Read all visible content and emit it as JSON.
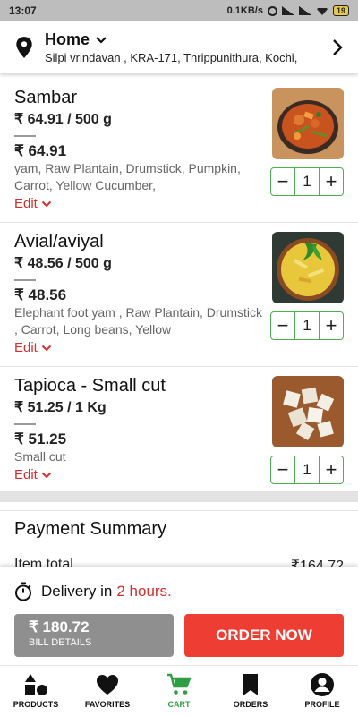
{
  "status_bar": {
    "time": "13:07",
    "net_speed": "0.1KB/s",
    "battery": "19"
  },
  "address": {
    "title": "Home",
    "line": "Silpi vrindavan , KRA-171, Thrippunithura, Kochi,"
  },
  "cart": {
    "items": [
      {
        "name": "Sambar",
        "unit_price": "₹ 64.91 / 500 g",
        "total": "₹ 64.91",
        "description": "yam, Raw Plantain, Drumstick, Pumpkin, Carrot, Yellow Cucumber,",
        "edit_label": "Edit",
        "quantity": "1",
        "minus": "−",
        "plus": "+"
      },
      {
        "name": "Avial/aviyal",
        "unit_price": "₹ 48.56 / 500 g",
        "total": "₹ 48.56",
        "description": "Elephant foot yam , Raw Plantain, Drumstick , Carrot, Long beans, Yellow",
        "edit_label": "Edit",
        "quantity": "1",
        "minus": "−",
        "plus": "+"
      },
      {
        "name": "Tapioca - Small cut",
        "unit_price": "₹ 51.25 / 1 Kg",
        "total": "₹ 51.25",
        "description": "Small cut",
        "edit_label": "Edit",
        "quantity": "1",
        "minus": "−",
        "plus": "+"
      }
    ]
  },
  "payment": {
    "title": "Payment Summary",
    "item_total_label": "Item total",
    "item_total_value": "₹164.72"
  },
  "checkout": {
    "delivery_prefix": "Delivery in",
    "delivery_time": "2 hours.",
    "bill_amount": "₹ 180.72",
    "bill_label": "BILL DETAILS",
    "order_label": "ORDER NOW"
  },
  "nav": {
    "items": [
      {
        "label": "PRODUCTS",
        "icon": "products-icon"
      },
      {
        "label": "FAVORITES",
        "icon": "heart-icon"
      },
      {
        "label": "CART",
        "icon": "cart-icon",
        "active": true
      },
      {
        "label": "ORDERS",
        "icon": "bookmark-icon"
      },
      {
        "label": "PROFILE",
        "icon": "profile-icon"
      }
    ]
  },
  "colors": {
    "accent_red": "#ee3e33",
    "link_red": "#d32f2f",
    "active_green": "#2e9e44",
    "stepper_green": "#4caf50",
    "bill_gray": "#8f8f8f"
  }
}
